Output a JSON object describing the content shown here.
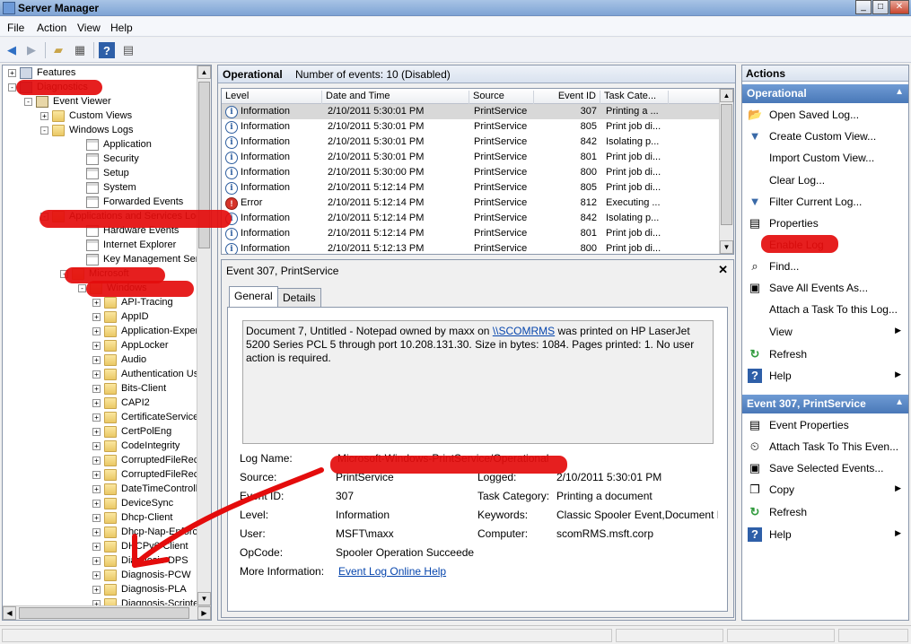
{
  "window": {
    "title": "Server Manager",
    "controls": [
      "_",
      "□",
      "✕"
    ]
  },
  "menu": [
    "File",
    "Action",
    "View",
    "Help"
  ],
  "toolbar": {
    "icons": [
      "back-icon",
      "forward-icon",
      "up-folder-icon",
      "show-hide-tree-icon",
      "help-icon",
      "properties-icon"
    ]
  },
  "tree": {
    "items": [
      {
        "label": "Features",
        "expander": "+",
        "icon": "features"
      },
      {
        "label": "Diagnostics",
        "expander": "-",
        "icon": "diag"
      },
      {
        "label": "Event Viewer",
        "expander": "-",
        "icon": "viewer"
      },
      {
        "label": "Custom Views",
        "expander": "+",
        "icon": "folder"
      },
      {
        "label": "Windows Logs",
        "expander": "-",
        "icon": "folder"
      },
      {
        "label": "Application",
        "expander": "",
        "icon": "log"
      },
      {
        "label": "Security",
        "expander": "",
        "icon": "log"
      },
      {
        "label": "Setup",
        "expander": "",
        "icon": "log"
      },
      {
        "label": "System",
        "expander": "",
        "icon": "log"
      },
      {
        "label": "Forwarded Events",
        "expander": "",
        "icon": "log"
      },
      {
        "label": "Applications and Services Log",
        "expander": "-",
        "icon": "folder"
      },
      {
        "label": "Hardware Events",
        "expander": "",
        "icon": "log"
      },
      {
        "label": "Internet Explorer",
        "expander": "",
        "icon": "log"
      },
      {
        "label": "Key Management Service",
        "expander": "",
        "icon": "log"
      },
      {
        "label": "Microsoft",
        "expander": "-",
        "icon": "folder"
      },
      {
        "label": "Windows",
        "expander": "-",
        "icon": "folder"
      },
      {
        "label": "API-Tracing",
        "expander": "+",
        "icon": "folder"
      },
      {
        "label": "AppID",
        "expander": "+",
        "icon": "folder"
      },
      {
        "label": "Application-Exper",
        "expander": "+",
        "icon": "folder"
      },
      {
        "label": "AppLocker",
        "expander": "+",
        "icon": "folder"
      },
      {
        "label": "Audio",
        "expander": "+",
        "icon": "folder"
      },
      {
        "label": "Authentication Us",
        "expander": "+",
        "icon": "folder"
      },
      {
        "label": "Bits-Client",
        "expander": "+",
        "icon": "folder"
      },
      {
        "label": "CAPI2",
        "expander": "+",
        "icon": "folder"
      },
      {
        "label": "CertificateService",
        "expander": "+",
        "icon": "folder"
      },
      {
        "label": "CertPolEng",
        "expander": "+",
        "icon": "folder"
      },
      {
        "label": "CodeIntegrity",
        "expander": "+",
        "icon": "folder"
      },
      {
        "label": "CorruptedFileRec",
        "expander": "+",
        "icon": "folder"
      },
      {
        "label": "CorruptedFileRec",
        "expander": "+",
        "icon": "folder"
      },
      {
        "label": "DateTimeControll",
        "expander": "+",
        "icon": "folder"
      },
      {
        "label": "DeviceSync",
        "expander": "+",
        "icon": "folder"
      },
      {
        "label": "Dhcp-Client",
        "expander": "+",
        "icon": "folder"
      },
      {
        "label": "Dhcp-Nap-Enforc",
        "expander": "+",
        "icon": "folder"
      },
      {
        "label": "DHCPv6-Client",
        "expander": "+",
        "icon": "folder"
      },
      {
        "label": "Diagnosis-DPS",
        "expander": "+",
        "icon": "folder"
      },
      {
        "label": "Diagnosis-PCW",
        "expander": "+",
        "icon": "folder"
      },
      {
        "label": "Diagnosis-PLA",
        "expander": "+",
        "icon": "folder"
      },
      {
        "label": "Diagnosis-Scripte",
        "expander": "+",
        "icon": "folder"
      }
    ]
  },
  "center": {
    "title": "Operational",
    "count": "Number of events: 10 (Disabled)",
    "columns": [
      "Level",
      "Date and Time",
      "Source",
      "Event ID",
      "Task Cate..."
    ],
    "rows": [
      {
        "level": "Information",
        "type": "info",
        "date": "2/10/2011 5:30:01 PM",
        "source": "PrintService",
        "id": "307",
        "task": "Printing a ..."
      },
      {
        "level": "Information",
        "type": "info",
        "date": "2/10/2011 5:30:01 PM",
        "source": "PrintService",
        "id": "805",
        "task": "Print job di..."
      },
      {
        "level": "Information",
        "type": "info",
        "date": "2/10/2011 5:30:01 PM",
        "source": "PrintService",
        "id": "842",
        "task": "Isolating p..."
      },
      {
        "level": "Information",
        "type": "info",
        "date": "2/10/2011 5:30:01 PM",
        "source": "PrintService",
        "id": "801",
        "task": "Print job di..."
      },
      {
        "level": "Information",
        "type": "info",
        "date": "2/10/2011 5:30:00 PM",
        "source": "PrintService",
        "id": "800",
        "task": "Print job di..."
      },
      {
        "level": "Information",
        "type": "info",
        "date": "2/10/2011 5:12:14 PM",
        "source": "PrintService",
        "id": "805",
        "task": "Print job di..."
      },
      {
        "level": "Error",
        "type": "error",
        "date": "2/10/2011 5:12:14 PM",
        "source": "PrintService",
        "id": "812",
        "task": "Executing ..."
      },
      {
        "level": "Information",
        "type": "info",
        "date": "2/10/2011 5:12:14 PM",
        "source": "PrintService",
        "id": "842",
        "task": "Isolating p..."
      },
      {
        "level": "Information",
        "type": "info",
        "date": "2/10/2011 5:12:14 PM",
        "source": "PrintService",
        "id": "801",
        "task": "Print job di..."
      },
      {
        "level": "Information",
        "type": "info",
        "date": "2/10/2011 5:12:13 PM",
        "source": "PrintService",
        "id": "800",
        "task": "Print job di..."
      }
    ],
    "level_glyphs": {
      "info": "i",
      "error": "!"
    }
  },
  "detail": {
    "title": "Event 307, PrintService",
    "close": "✕",
    "tabs": [
      "General",
      "Details"
    ],
    "description": {
      "before": "Document 7, Untitled - Notepad owned by maxx on ",
      "link": "\\\\SCOMRMS",
      "after": " was printed on HP LaserJet 5200 Series PCL 5 through port 10.208.131.30.  Size in bytes: 1084. Pages printed: 1. No user action is required."
    },
    "props": {
      "log_name_label": "Log Name:",
      "log_name": "Microsoft-Windows-PrintService/Operational",
      "source_label": "Source:",
      "source": "PrintService",
      "logged_label": "Logged:",
      "logged": "2/10/2011 5:30:01 PM",
      "event_id_label": "Event ID:",
      "event_id": "307",
      "task_label": "Task Category:",
      "task": "Printing a document",
      "level_label": "Level:",
      "level": "Information",
      "keywords_label": "Keywords:",
      "keywords": "Classic Spooler Event,Document P",
      "user_label": "User:",
      "user": "MSFT\\maxx",
      "computer_label": "Computer:",
      "computer": "scomRMS.msft.corp",
      "opcode_label": "OpCode:",
      "opcode": "Spooler Operation Succeede",
      "more_info_label": "More Information:",
      "more_info_link": "Event Log Online Help"
    }
  },
  "actions": {
    "header": "Actions",
    "section1": {
      "title": "Operational",
      "items": [
        {
          "label": "Open Saved Log...",
          "icon": "open-log-icon",
          "glyph": "📂"
        },
        {
          "label": "Create Custom View...",
          "icon": "filter-icon",
          "glyph": "▼"
        },
        {
          "label": "Import Custom View...",
          "icon": "",
          "glyph": ""
        },
        {
          "label": "Clear Log...",
          "icon": "",
          "glyph": ""
        },
        {
          "label": "Filter Current Log...",
          "icon": "filter-icon",
          "glyph": "▼"
        },
        {
          "label": "Properties",
          "icon": "properties-icon",
          "glyph": "▤"
        },
        {
          "label": "Enable Log",
          "icon": "",
          "glyph": ""
        },
        {
          "label": "Find...",
          "icon": "binoculars-icon",
          "glyph": "⌕"
        },
        {
          "label": "Save All Events As...",
          "icon": "save-icon",
          "glyph": "▣"
        },
        {
          "label": "Attach a Task To this Log...",
          "icon": "",
          "glyph": ""
        },
        {
          "label": "View",
          "icon": "",
          "glyph": "",
          "submenu": "▶"
        },
        {
          "label": "Refresh",
          "icon": "refresh-icon",
          "glyph": "↻"
        },
        {
          "label": "Help",
          "icon": "help-icon",
          "glyph": "?",
          "submenu": "▶"
        }
      ]
    },
    "section2": {
      "title": "Event 307, PrintService",
      "items": [
        {
          "label": "Event Properties",
          "icon": "properties-icon",
          "glyph": "▤"
        },
        {
          "label": "Attach Task To This Even...",
          "icon": "task-icon",
          "glyph": "⏲"
        },
        {
          "label": "Save Selected Events...",
          "icon": "save-icon",
          "glyph": "▣"
        },
        {
          "label": "Copy",
          "icon": "copy-icon",
          "glyph": "❐",
          "submenu": "▶"
        },
        {
          "label": "Refresh",
          "icon": "refresh-icon",
          "glyph": "↻"
        },
        {
          "label": "Help",
          "icon": "help-icon",
          "glyph": "?",
          "submenu": "▶"
        }
      ]
    },
    "collapse_glyph": "▲"
  },
  "colors": {
    "annotation_red": "#e40c0c",
    "link_blue": "#0645ad",
    "section_blue": "#4978b8"
  }
}
